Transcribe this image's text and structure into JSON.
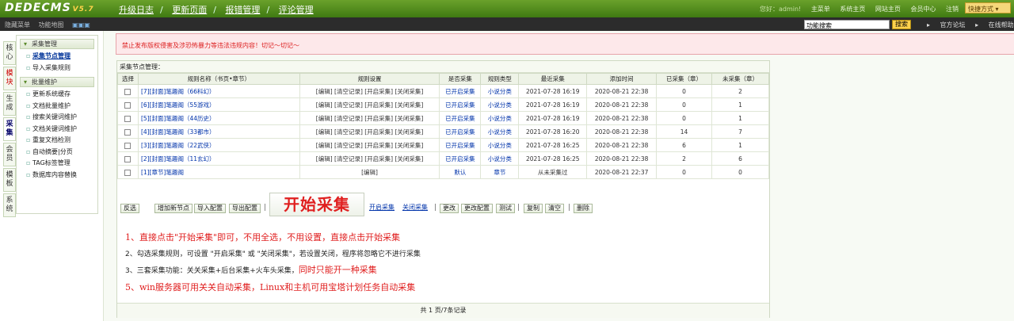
{
  "topbar": {
    "logo": "DEDECMS",
    "version": "V5.7",
    "nav": [
      "升级日志",
      "更新页面",
      "报错管理",
      "评论管理"
    ],
    "greeting": "您好：admin!",
    "links": [
      "主菜单",
      "系统主页",
      "网站主页",
      "会员中心",
      "注销"
    ],
    "quick": "快捷方式 ▾"
  },
  "bar2": {
    "hide_menu": "隐藏菜单",
    "site_map": "功能地图",
    "search_value": "功能搜索",
    "search_button": "搜索",
    "forum": "官方论坛",
    "help": "在线帮助"
  },
  "lefttabs": [
    "核心",
    "模块",
    "生成",
    "采集",
    "会员",
    "模板",
    "系统"
  ],
  "menu": {
    "group1": "采集管理",
    "items1": [
      "采集节点管理",
      "导入采集规则"
    ],
    "group2": "批量维护",
    "items2": [
      "更新系统缓存",
      "文档批量维护",
      "搜索关键词维护",
      "文档关键词维护",
      "重复文档检测",
      "自动摘要|分页",
      "TAG标签管理",
      "数据库内容替换"
    ]
  },
  "warning": "禁止发布版权侵害及涉恐怖暴力等违法违规内容！切记～切记～",
  "box_title": "采集节点管理：",
  "headers": [
    "选择",
    "规则名称（书页•章节）",
    "规则设置",
    "是否采集",
    "规则类型",
    "最近采集",
    "添加时间",
    "已采集（章）",
    "未采集（章）"
  ],
  "rows": [
    {
      "name": "[7][封面]笔趣阁（66科幻）",
      "setting": "[编辑] [清空记录] [开启采集] [关闭采集]",
      "status": "已开启采集",
      "type": "小说分类",
      "last": "2021-07-28 16:19",
      "added": "2020-08-21 22:38",
      "done": "0",
      "todo": "2"
    },
    {
      "name": "[6][封面]笔趣阁（55游戏）",
      "setting": "[编辑] [清空记录] [开启采集] [关闭采集]",
      "status": "已开启采集",
      "type": "小说分类",
      "last": "2021-07-28 16:19",
      "added": "2020-08-21 22:38",
      "done": "0",
      "todo": "1"
    },
    {
      "name": "[5][封面]笔趣阁（44历史）",
      "setting": "[编辑] [清空记录] [开启采集] [关闭采集]",
      "status": "已开启采集",
      "type": "小说分类",
      "last": "2021-07-28 16:19",
      "added": "2020-08-21 22:38",
      "done": "0",
      "todo": "1"
    },
    {
      "name": "[4][封面]笔趣阁（33都市）",
      "setting": "[编辑] [清空记录] [开启采集] [关闭采集]",
      "status": "已开启采集",
      "type": "小说分类",
      "last": "2021-07-28 16:20",
      "added": "2020-08-21 22:38",
      "done": "14",
      "todo": "7"
    },
    {
      "name": "[3][封面]笔趣阁（22武侠）",
      "setting": "[编辑] [清空记录] [开启采集] [关闭采集]",
      "status": "已开启采集",
      "type": "小说分类",
      "last": "2021-07-28 16:25",
      "added": "2020-08-21 22:38",
      "done": "6",
      "todo": "1"
    },
    {
      "name": "[2][封面]笔趣阁（11玄幻）",
      "setting": "[编辑] [清空记录] [开启采集] [关闭采集]",
      "status": "已开启采集",
      "type": "小说分类",
      "last": "2021-07-28 16:25",
      "added": "2020-08-21 22:38",
      "done": "2",
      "todo": "6"
    },
    {
      "name": "[1][章节]笔趣阁",
      "setting": "[编辑]",
      "status": "默认",
      "type": "章节",
      "last": "从未采集过",
      "added": "2020-08-21 22:37",
      "done": "0",
      "todo": "0"
    }
  ],
  "buttons": {
    "invert": "反选",
    "add_node": "增加新节点",
    "import": "导入配置",
    "export": "导出配置",
    "start": "开始采集",
    "enable": "开启采集",
    "disable": "关闭采集",
    "modify": "更改",
    "modify_config": "更改配置",
    "test": "测试",
    "copy": "复制",
    "clear": "清空",
    "delete": "删除"
  },
  "notes": {
    "n1": "1、直接点击\"开始采集\"即可，不用全选，不用设置，直接点击开始采集",
    "n2": "2、勾选采集规则，可设置 \"开启采集\" 或 \"关闭采集\"，若设置关闭，程序将忽略它不进行采集",
    "n3a": "3、三套采集功能：关关采集+后台采集+火车头采集，",
    "n3b": "同时只能开一种采集",
    "n5": "5、win服务器可用关关自动采集，Linux和主机可用宝塔计划任务自动采集"
  },
  "pager": "共 1 页/7条记录"
}
